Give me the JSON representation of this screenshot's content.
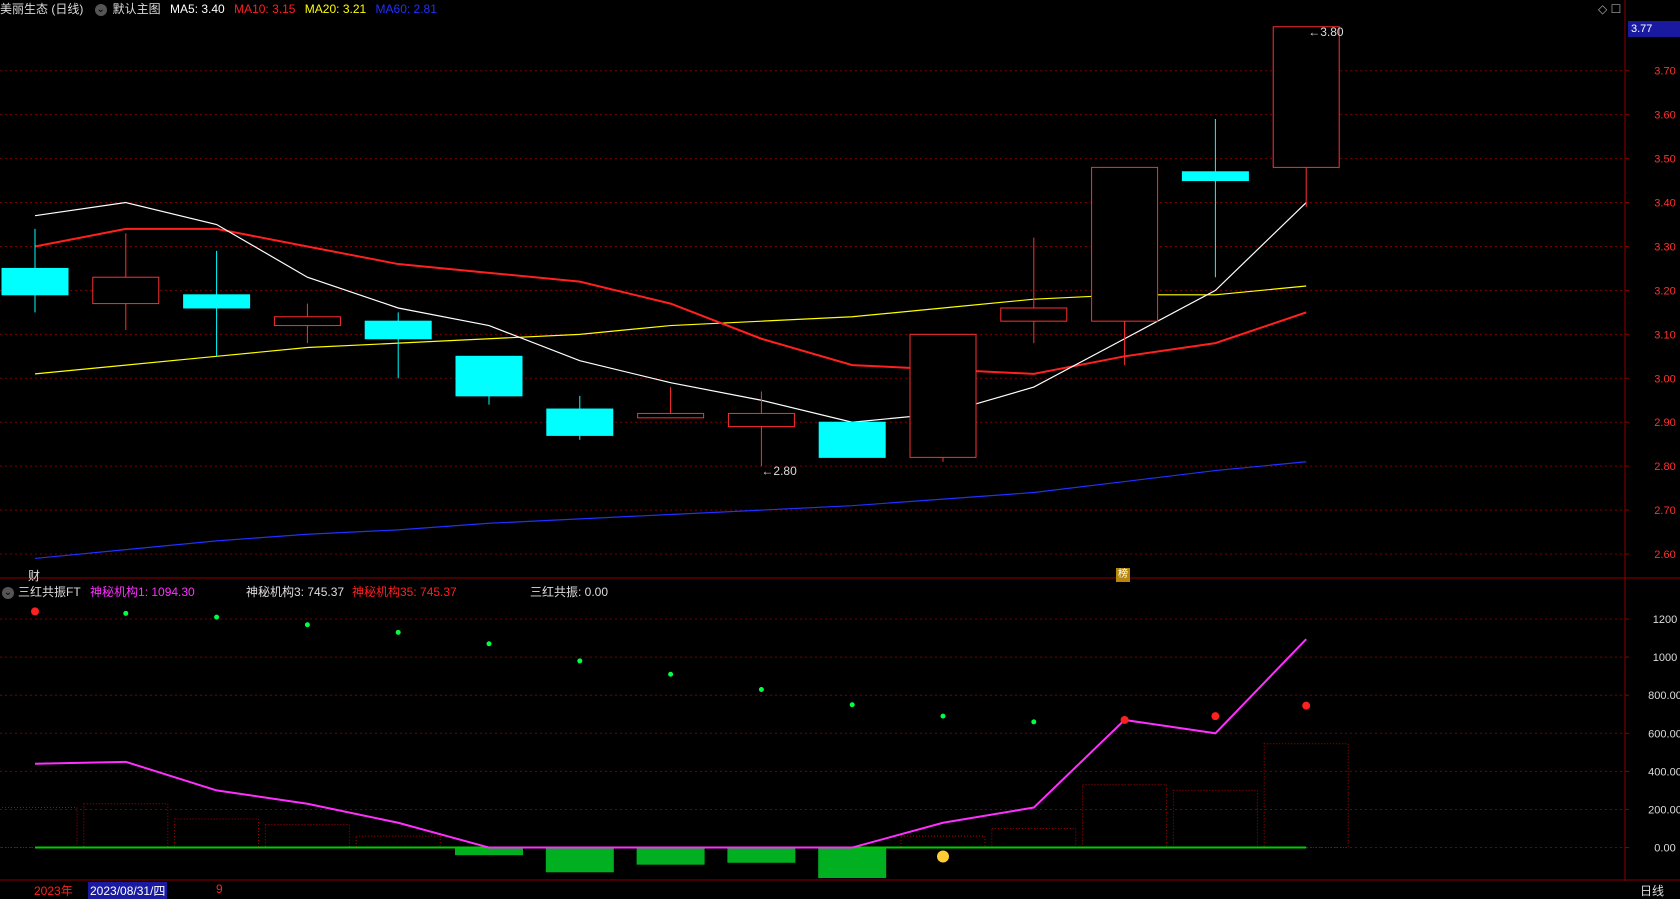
{
  "header": {
    "stock_title": "美丽生态 (日线)",
    "template_label": "默认主图",
    "ma5_label": "MA5: 3.40",
    "ma10_label": "MA10: 3.15",
    "ma20_label": "MA20: 3.21",
    "ma60_label": "MA60: 2.81",
    "colors": {
      "ma5": "#ffffff",
      "ma10": "#ff2020",
      "ma20": "#ffff00",
      "ma60": "#2030ff",
      "up": "#ff3030",
      "down": "#00ffff"
    }
  },
  "price_badge": "3.77",
  "markers": {
    "high_label": "3.80",
    "low_label": "2.80",
    "cai": "财",
    "bang": "榜"
  },
  "price_axis": {
    "ticks": [
      "3.70",
      "3.60",
      "3.50",
      "3.40",
      "3.30",
      "3.20",
      "3.10",
      "3.00",
      "2.90",
      "2.80",
      "2.70",
      "2.60"
    ],
    "min": 2.55,
    "max": 3.82
  },
  "candles": [
    {
      "o": 3.25,
      "c": 3.19,
      "h": 3.34,
      "l": 3.15
    },
    {
      "o": 3.17,
      "c": 3.23,
      "h": 3.33,
      "l": 3.11
    },
    {
      "o": 3.19,
      "c": 3.16,
      "h": 3.29,
      "l": 3.05
    },
    {
      "o": 3.12,
      "c": 3.14,
      "h": 3.17,
      "l": 3.08
    },
    {
      "o": 3.13,
      "c": 3.09,
      "h": 3.15,
      "l": 3.0
    },
    {
      "o": 3.05,
      "c": 2.96,
      "h": 3.05,
      "l": 2.94
    },
    {
      "o": 2.93,
      "c": 2.87,
      "h": 2.96,
      "l": 2.86
    },
    {
      "o": 2.91,
      "c": 2.92,
      "h": 2.98,
      "l": 2.91
    },
    {
      "o": 2.89,
      "c": 2.92,
      "h": 2.97,
      "l": 2.8
    },
    {
      "o": 2.9,
      "c": 2.82,
      "h": 2.9,
      "l": 2.82
    },
    {
      "o": 2.82,
      "c": 3.1,
      "h": 3.1,
      "l": 2.81
    },
    {
      "o": 3.13,
      "c": 3.16,
      "h": 3.32,
      "l": 3.08
    },
    {
      "o": 3.13,
      "c": 3.48,
      "h": 3.48,
      "l": 3.03
    },
    {
      "o": 3.47,
      "c": 3.45,
      "h": 3.59,
      "l": 3.23
    },
    {
      "o": 3.48,
      "c": 3.8,
      "h": 3.8,
      "l": 3.39
    }
  ],
  "ma_lines": {
    "ma5": [
      3.37,
      3.4,
      3.35,
      3.23,
      3.16,
      3.12,
      3.04,
      2.99,
      2.95,
      2.9,
      2.92,
      2.98,
      3.09,
      3.2,
      3.4
    ],
    "ma10": [
      3.3,
      3.34,
      3.34,
      3.3,
      3.26,
      3.24,
      3.22,
      3.17,
      3.09,
      3.03,
      3.02,
      3.01,
      3.05,
      3.08,
      3.15
    ],
    "ma20": [
      3.01,
      3.03,
      3.05,
      3.07,
      3.08,
      3.09,
      3.1,
      3.12,
      3.13,
      3.14,
      3.16,
      3.18,
      3.19,
      3.19,
      3.21
    ],
    "ma60": [
      2.59,
      2.61,
      2.63,
      2.645,
      2.655,
      2.67,
      2.68,
      2.69,
      2.7,
      2.71,
      2.725,
      2.74,
      2.765,
      2.79,
      2.81
    ]
  },
  "indicator": {
    "name": "三红共振FT",
    "s1_label": "神秘机构1: 1094.30",
    "s3_label": "神秘机构3: 745.37",
    "s35_label": "神秘机构35: 745.37",
    "resonance_label": "三红共振: 0.00",
    "axis_ticks": [
      "1200",
      "1000",
      "800.00",
      "600.00",
      "400.00",
      "200.00",
      "0.00"
    ],
    "min": -160,
    "max": 1300,
    "line": [
      440,
      450,
      300,
      230,
      130,
      0,
      0,
      0,
      0,
      0,
      130,
      210,
      670,
      600,
      1094
    ],
    "dots": [
      1240,
      1230,
      1210,
      1170,
      1130,
      1070,
      980,
      910,
      830,
      750,
      690,
      660,
      670,
      690,
      745
    ],
    "dot_colors": [
      "#ff2020",
      "#00ff40",
      "#00ff40",
      "#00ff40",
      "#00ff40",
      "#00ff40",
      "#00ff40",
      "#00ff40",
      "#00ff40",
      "#00ff40",
      "#00ff40",
      "#00ff40",
      "#ff2020",
      "#ff2020",
      "#ff2020"
    ],
    "bars": [
      210,
      230,
      150,
      120,
      60,
      -40,
      -130,
      -90,
      -80,
      -160,
      60,
      100,
      330,
      300,
      545
    ]
  },
  "footer": {
    "year": "2023年",
    "date": "2023/08/31/四",
    "extra": "9",
    "period": "日线"
  }
}
